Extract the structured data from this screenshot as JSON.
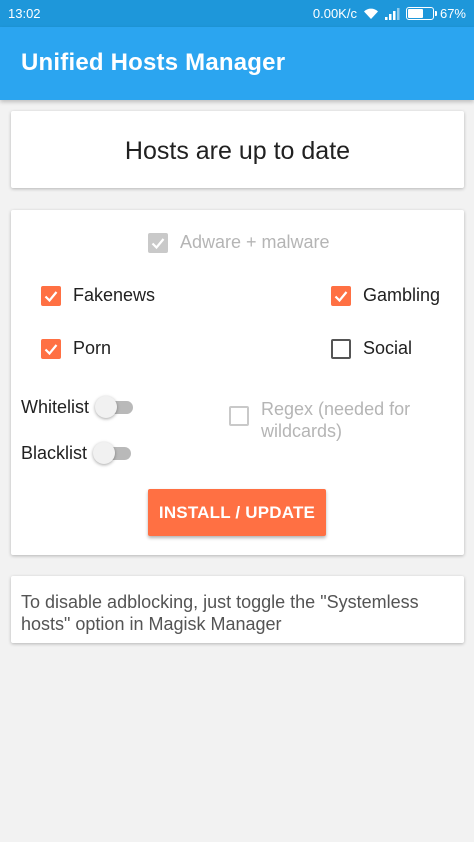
{
  "status_bar": {
    "time": "13:02",
    "speed": "0.00K/c",
    "battery": "67%",
    "battery_level": 0.67,
    "icons": [
      "wifi-icon",
      "signal-icon",
      "battery-icon"
    ]
  },
  "app_bar": {
    "title": "Unified Hosts Manager",
    "color": "#2ba5f0"
  },
  "status_card": {
    "text": "Hosts are up to date"
  },
  "options": {
    "base": {
      "label": "Adware + malware",
      "checked": true,
      "enabled": false
    },
    "categories": [
      {
        "label": "Fakenews",
        "checked": true
      },
      {
        "label": "Gambling",
        "checked": true
      },
      {
        "label": "Porn",
        "checked": true
      },
      {
        "label": "Social",
        "checked": false
      }
    ],
    "whitelist": {
      "label": "Whitelist",
      "on": false
    },
    "blacklist": {
      "label": "Blacklist",
      "on": false
    },
    "regex": {
      "label": "Regex (needed for wildcards)",
      "checked": false,
      "enabled": false
    },
    "install_button": "INSTALL / UPDATE",
    "accent_color": "#ff7043"
  },
  "info_card": {
    "text": "To disable adblocking, just toggle the \"Systemless hosts\" option in Magisk Manager"
  }
}
